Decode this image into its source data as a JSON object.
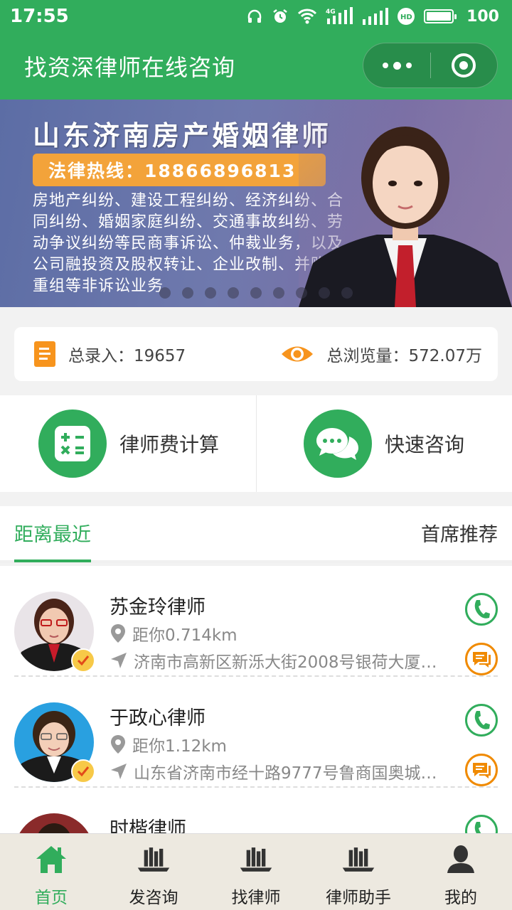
{
  "status_bar": {
    "time": "17:55",
    "network": "4G",
    "battery": "100",
    "icons": [
      "headphones-icon",
      "alarm-icon",
      "wifi-icon",
      "signal-icon",
      "hd-icon",
      "battery-icon"
    ]
  },
  "header": {
    "title": "找资深律师在线咨询"
  },
  "banner": {
    "title": "山东济南房产婚姻律师",
    "hotline": "法律热线：18866896813",
    "description": "房地产纠纷、建设工程纠纷、经济纠纷、合同纠纷、婚姻家庭纠纷、交通事故纠纷、劳动争议纠纷等民商事诉讼、仲裁业务，以及公司融投资及股权转让、企业改制、并购、重组等非诉讼业务",
    "slide_count": 9,
    "active_slide": 0
  },
  "stats": {
    "records_label": "总录入：",
    "records_value": "19657",
    "views_label": "总浏览量：",
    "views_value": "572.07万"
  },
  "features": {
    "fee_calc": "律师费计算",
    "quick_consult": "快速咨询"
  },
  "tabs": {
    "nearest": "距离最近",
    "recommended": "首席推荐"
  },
  "lawyers": [
    {
      "name": "苏金玲律师",
      "distance": "距你0.714km",
      "address": "济南市高新区新泺大街2008号银荷大厦…"
    },
    {
      "name": "于政心律师",
      "distance": "距你1.12km",
      "address": "山东省济南市经十路9777号鲁商国奥城…"
    },
    {
      "name": "时楷律师",
      "distance": "",
      "address": ""
    }
  ],
  "tabbar": {
    "home": "首页",
    "post_consult": "发咨询",
    "find_lawyer": "找律师",
    "assistant": "律师助手",
    "mine": "我的"
  },
  "colors": {
    "brand_green": "#31ad5c",
    "accent_orange": "#f7941d"
  }
}
